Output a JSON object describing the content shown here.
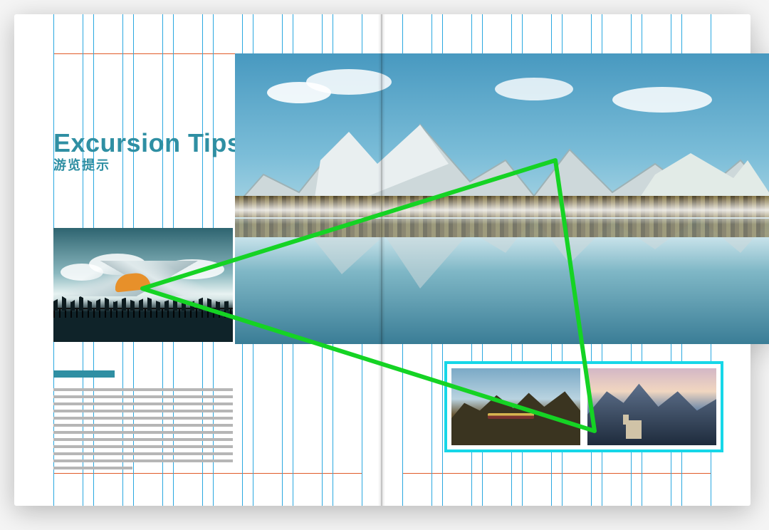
{
  "heading": {
    "en": "Excursion Tips",
    "cn": "游览提示"
  },
  "grid": {
    "columns_per_page": 8,
    "guide_color": "#2aa8e0",
    "margin_color": "#e05b2a"
  },
  "overlay": {
    "triangle_stroke": "#15d324",
    "thumb_highlight_stroke": "#16d7e8"
  },
  "images": {
    "left_small": "observation-deck-with-paraglider",
    "hero": "mountain-lake-with-reflection",
    "thumbs": [
      "mountain-village-with-funicular",
      "castle-by-lake-with-snowy-peaks"
    ]
  },
  "placeholder_lines": 12
}
